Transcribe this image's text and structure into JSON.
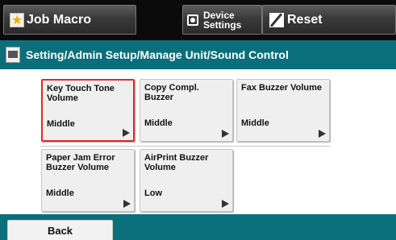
{
  "topbar": {
    "job_macro_label": "Job Macro",
    "device_settings_line1": "Device",
    "device_settings_line2": "Settings",
    "reset_label": "Reset"
  },
  "header": {
    "breadcrumb": "Setting/Admin Setup/Manage Unit/Sound Control"
  },
  "tiles": [
    {
      "title": "Key Touch Tone Volume",
      "value": "Middle",
      "selected": true
    },
    {
      "title": "Copy Compl. Buzzer",
      "value": "Middle",
      "selected": false
    },
    {
      "title": "Fax Buzzer Volume",
      "value": "Middle",
      "selected": false
    },
    {
      "title": "Paper Jam Error Buzzer Volume",
      "value": "Middle",
      "selected": false
    },
    {
      "title": "AirPrint Buzzer Volume",
      "value": "Low",
      "selected": false
    }
  ],
  "footer": {
    "back_label": "Back"
  },
  "colors": {
    "accent_teal": "#0b6f7b",
    "selection_red": "#e02a2a",
    "topbar_black": "#0b0b0b"
  },
  "icons": {
    "job_macro": "star-icon",
    "device_settings": "device-settings-icon",
    "reset": "reset-icon",
    "header": "settings-page-icon",
    "tile_arrow": "arrow-right-icon"
  }
}
